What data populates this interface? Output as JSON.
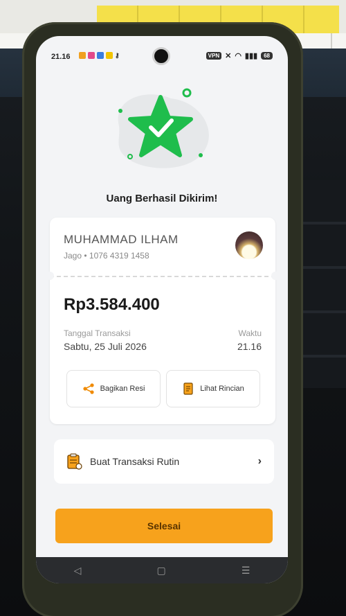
{
  "status_bar": {
    "time": "21.16",
    "vpn_label": "VPN",
    "battery": "68",
    "icons": [
      "signal-icon",
      "wifi-icon",
      "mute-icon",
      "key-icon"
    ]
  },
  "success": {
    "title": "Uang Berhasil Dikirim!",
    "icon": "star-check-icon",
    "accent_color": "#1fbd4c"
  },
  "receipt": {
    "recipient_name": "MUHAMMAD ILHAM",
    "recipient_account": "Jago • 1076 4319 1458",
    "amount": "Rp3.584.400",
    "date_label": "Tanggal Transaksi",
    "date_value": "Sabtu, 25 Juli 2026",
    "time_label": "Waktu",
    "time_value": "21.16"
  },
  "actions": {
    "share_label": "Bagikan Resi",
    "detail_label": "Lihat Rincian"
  },
  "routine": {
    "label": "Buat Transaksi Rutin"
  },
  "done_button": {
    "label": "Selesai",
    "color": "#f7a21c"
  },
  "navigation": {
    "back_icon": "◁",
    "home_icon": "▢",
    "recent_icon": "☰"
  }
}
